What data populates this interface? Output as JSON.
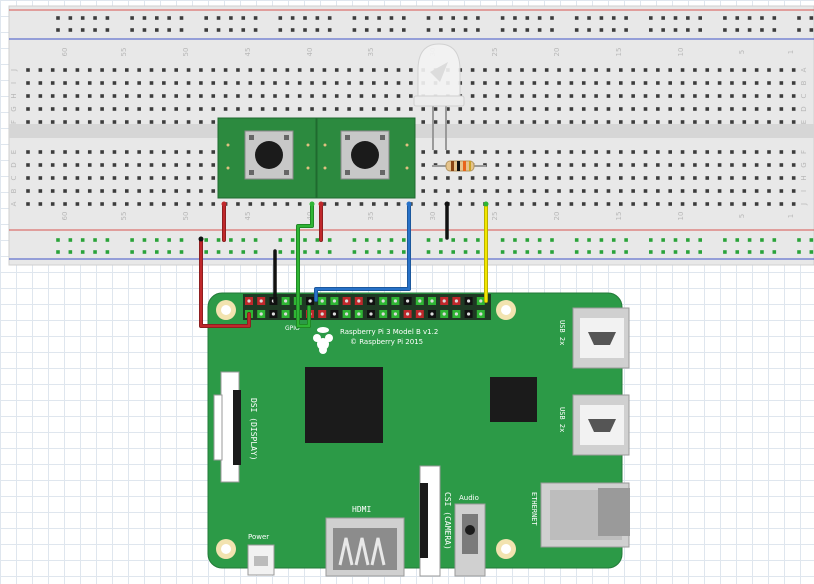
{
  "breadboard": {
    "column_numbers_top": [
      "60",
      "55",
      "50",
      "45",
      "40",
      "35",
      "30",
      "25",
      "20",
      "15",
      "10",
      "5",
      "1"
    ],
    "column_numbers_bottom": [
      "60",
      "55",
      "50",
      "45",
      "40",
      "35",
      "30",
      "25",
      "20",
      "15",
      "10",
      "5",
      "1"
    ],
    "row_letters_left_top": [
      "J",
      "I",
      "H",
      "G",
      "F"
    ],
    "row_letters_right_top": [
      "A",
      "B",
      "C",
      "D",
      "E"
    ],
    "row_letters_left_bottom": [
      "E",
      "D",
      "C",
      "B",
      "A"
    ],
    "row_letters_right_bottom": [
      "F",
      "G",
      "H",
      "I",
      "J"
    ]
  },
  "raspberry_pi": {
    "model_line": "Raspberry Pi 3 Model B v1.2",
    "copyright_line": "© Raspberry Pi 2015",
    "gpio_label": "GPIO",
    "usb_label_1": "USB 2x",
    "usb_label_2": "USB 2x",
    "ethernet_label": "ETHERNET",
    "hdmi_label": "HDMI",
    "csi_label": "CSI (CAMERA)",
    "dsi_label": "DSI (DISPLAY)",
    "audio_label": "Audio",
    "power_label": "Power"
  },
  "colors": {
    "breadboard": "#e6e6e6",
    "rail_red": "#d9534f",
    "rail_blue": "#3f55c8",
    "pcb_green": "#2c9a47",
    "button_green": "#2c8a3f",
    "wire_red": "#c0282b",
    "wire_black": "#111111",
    "wire_green": "#2fb534",
    "wire_blue": "#2872c8",
    "wire_yellow": "#f2e600"
  },
  "components": [
    {
      "name": "Pushbutton 1"
    },
    {
      "name": "Pushbutton 2"
    },
    {
      "name": "LED (white)"
    },
    {
      "name": "Resistor"
    }
  ]
}
